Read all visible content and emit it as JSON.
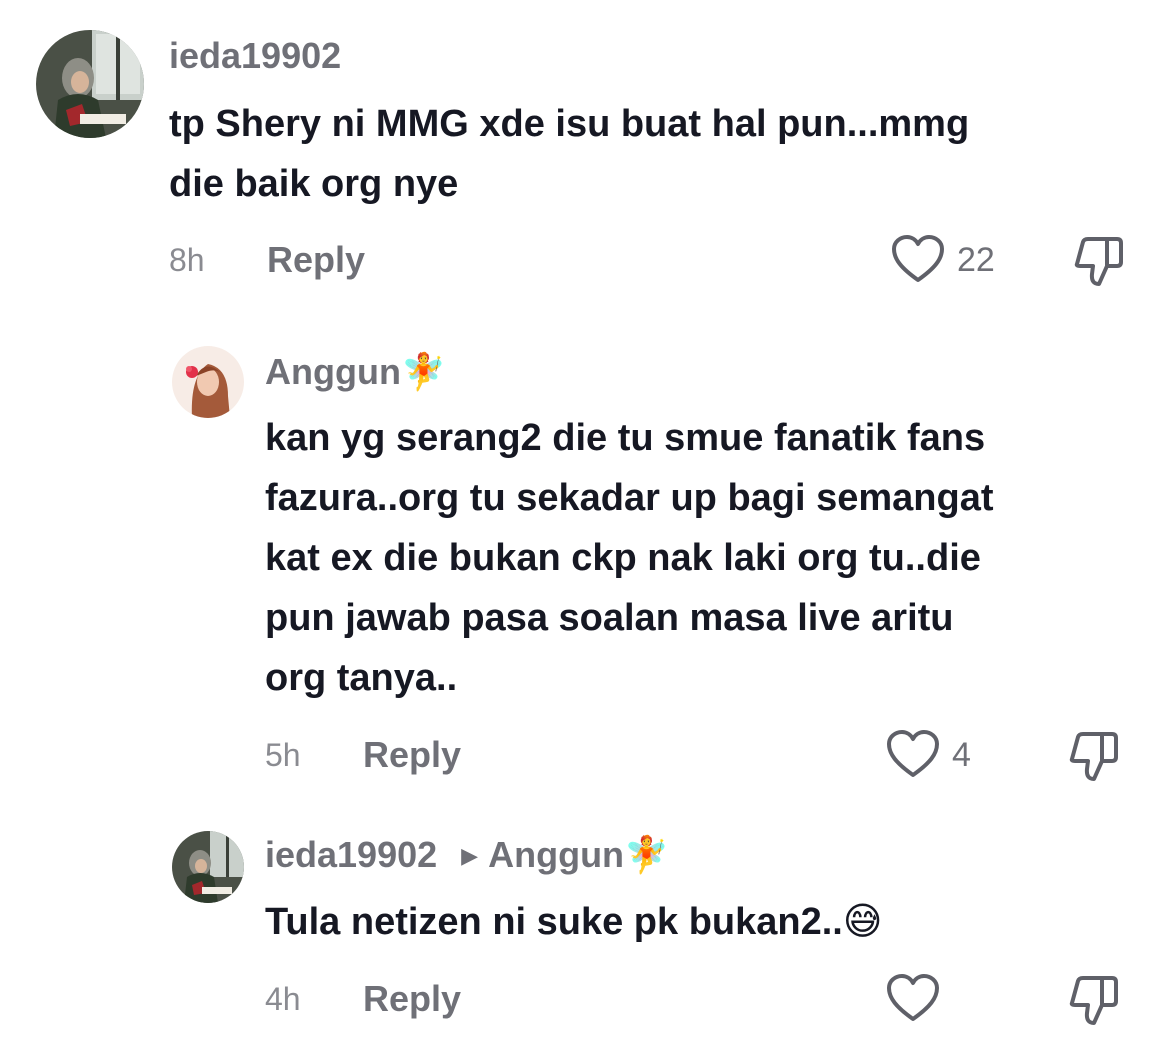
{
  "comments": [
    {
      "username": "ieda19902",
      "text_line1": "tp Shery ni MMG xde isu buat hal pun...mmg",
      "text_line2": "die baik org nye",
      "time": "8h",
      "reply_label": "Reply",
      "likes": "22"
    },
    {
      "username": "Anggun",
      "username_emoji": "🧚",
      "text_line1": "kan yg serang2 die tu smue fanatik fans",
      "text_line2": "fazura..org tu sekadar up bagi semangat",
      "text_line3": "kat ex die bukan ckp nak laki org tu..die",
      "text_line4": "pun jawab pasa soalan masa live aritu",
      "text_line5": "org tanya..",
      "time": "5h",
      "reply_label": "Reply",
      "likes": "4"
    },
    {
      "username": "ieda19902",
      "reply_to": "Anggun",
      "reply_to_emoji": "🧚",
      "text": "Tula netizen ni suke pk bukan2..",
      "text_emoji": "😅",
      "time": "4h",
      "reply_label": "Reply",
      "likes": ""
    }
  ],
  "icons": {
    "like": "heart-outline-icon",
    "dislike": "thumbs-down-outline-icon",
    "reply_arrow": "caret-right-icon"
  },
  "colors": {
    "text": "#161823",
    "muted": "#6f7077",
    "timestamp": "#8a8b91",
    "background": "#ffffff"
  }
}
